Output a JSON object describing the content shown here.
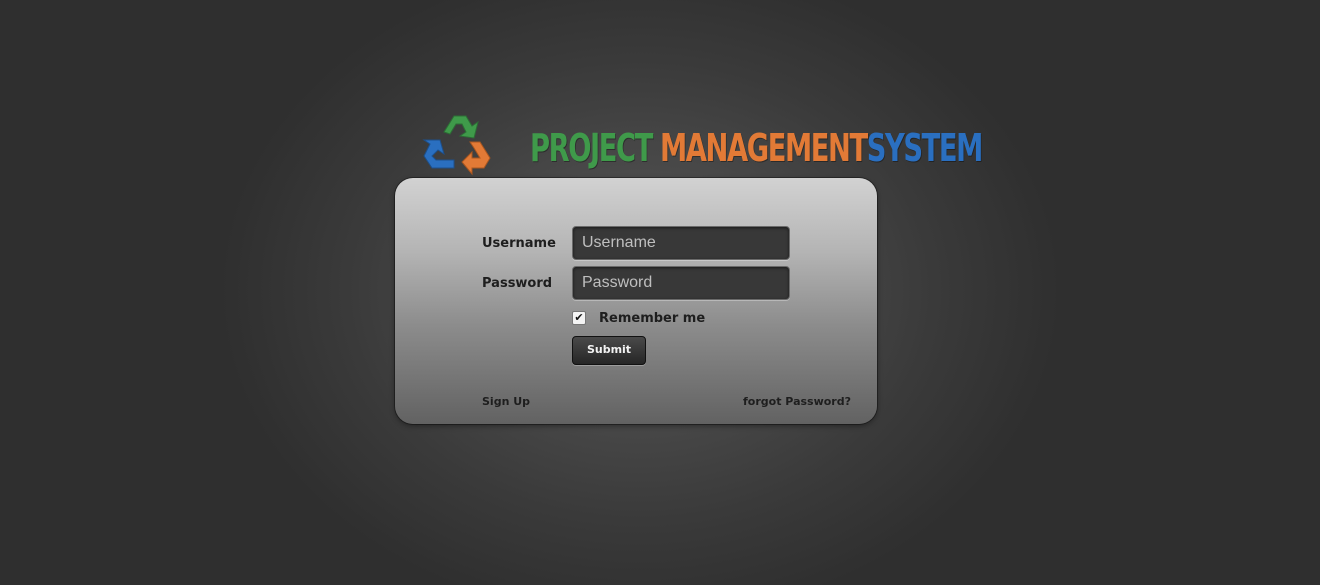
{
  "logo": {
    "word1": "PROJECT",
    "word2": "MANAGEMENT",
    "word3": "SYSTEM",
    "colors": {
      "green": "#3f9a4a",
      "orange": "#e27a36",
      "blue": "#2a6fc0"
    },
    "icon": "recycle-arrows-icon"
  },
  "login": {
    "username_label": "Username",
    "username_placeholder": "Username",
    "password_label": "Password",
    "password_placeholder": "Password",
    "remember_label": "Remember me",
    "remember_checked": true,
    "submit_label": "Submit",
    "signup_link": "Sign Up",
    "forgot_link": "forgot Password?"
  }
}
